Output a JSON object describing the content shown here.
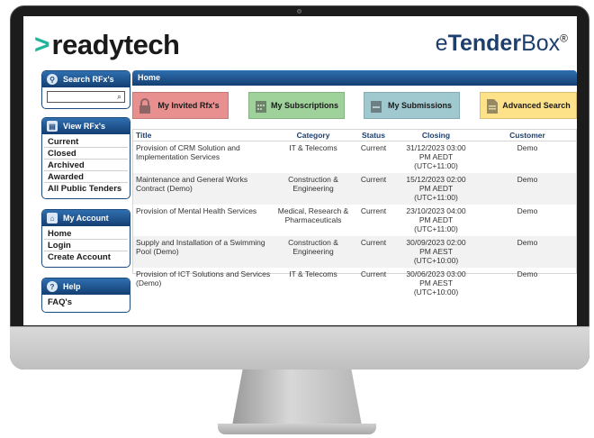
{
  "brand": {
    "logo_chevron": ">",
    "logo_text": "readytech",
    "product_prefix": "e",
    "product_bold": "Tender",
    "product_suffix": "Box",
    "product_mark": "®"
  },
  "sidebar": {
    "search": {
      "title": "Search RFx's",
      "search_icon": "⌕",
      "input_value": ""
    },
    "view": {
      "title": "View RFx's",
      "items": [
        "Current",
        "Closed",
        "Archived",
        "Awarded",
        "All Public Tenders"
      ]
    },
    "account": {
      "title": "My Account",
      "items": [
        "Home",
        "Login",
        "Create Account"
      ]
    },
    "help": {
      "title": "Help",
      "help_glyph": "?",
      "items": [
        "FAQ's"
      ]
    }
  },
  "main": {
    "breadcrumb": "Home",
    "tiles": [
      {
        "label": "My Invited Rfx's",
        "color": "#e88f8f",
        "icon": "lock-icon"
      },
      {
        "label": "My Subscriptions",
        "color": "#9ed29a",
        "icon": "calendar-icon"
      },
      {
        "label": "My Submissions",
        "color": "#9fc9cf",
        "icon": "inbox-icon"
      },
      {
        "label": "Advanced Search",
        "color": "#fde28a",
        "icon": "document-icon"
      }
    ],
    "table": {
      "headers": [
        "Title",
        "Category",
        "Status",
        "Closing",
        "Customer"
      ],
      "rows": [
        {
          "title": "Provision of CRM Solution and Implementation Services",
          "category": "IT & Telecoms",
          "status": "Current",
          "closing": [
            "31/12/2023 03:00",
            "PM AEDT",
            "(UTC+11:00)"
          ],
          "customer": "Demo"
        },
        {
          "title": "Maintenance and General Works Contract (Demo)",
          "category": "Construction & Engineering",
          "status": "Current",
          "closing": [
            "15/12/2023 02:00",
            "PM AEDT",
            "(UTC+11:00)"
          ],
          "customer": "Demo"
        },
        {
          "title": "Provision of Mental Health Services",
          "category": "Medical, Research & Pharmaceuticals",
          "status": "Current",
          "closing": [
            "23/10/2023 04:00",
            "PM AEDT",
            "(UTC+11:00)"
          ],
          "customer": "Demo"
        },
        {
          "title": "Supply and Installation of a Swimming Pool (Demo)",
          "category": "Construction & Engineering",
          "status": "Current",
          "closing": [
            "30/09/2023 02:00",
            "PM AEST",
            "(UTC+10:00)"
          ],
          "customer": "Demo"
        },
        {
          "title": "Provision of ICT Solutions and Services (Demo)",
          "category": "IT & Telecoms",
          "status": "Current",
          "closing": [
            "30/06/2023 03:00",
            "PM AEST",
            "(UTC+10:00)"
          ],
          "customer": "Demo"
        }
      ]
    }
  },
  "colors": {
    "nav_blue": "#1d4a7c",
    "brand_green": "#1fb59a",
    "brand_navy": "#1d3f6e"
  }
}
